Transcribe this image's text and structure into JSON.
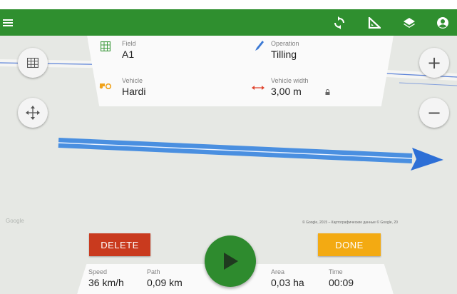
{
  "toolbar": {
    "menu_icon": "hamburger-menu-icon",
    "actions": [
      "sync-icon",
      "ruler-triangle-icon",
      "layers-icon",
      "account-icon"
    ]
  },
  "info_top": {
    "field": {
      "label": "Field",
      "value": "A1"
    },
    "operation": {
      "label": "Operation",
      "value": "Tilling"
    },
    "vehicle": {
      "label": "Vehicle",
      "value": "Hardi"
    },
    "vehicle_width": {
      "label": "Vehicle width",
      "value": "3,00 m"
    }
  },
  "info_bottom": {
    "speed": {
      "label": "Speed",
      "value": "36 km/h"
    },
    "path": {
      "label": "Path",
      "value": "0,09 km"
    },
    "area": {
      "label": "Area",
      "value": "0,03 ha"
    },
    "time": {
      "label": "Time",
      "value": "00:09"
    }
  },
  "buttons": {
    "delete_label": "DELETE",
    "done_label": "DONE",
    "zoom_in": "+",
    "zoom_out": "−"
  },
  "map": {
    "attribution": "© Google, 2015 – Картографические данные © Google, 20",
    "watermark": "Google"
  },
  "colors": {
    "toolbar": "#2f8f2f",
    "delete": "#c93a1e",
    "done": "#f3aa12",
    "play": "#2e8b2e",
    "track": "#4a8fe0"
  }
}
